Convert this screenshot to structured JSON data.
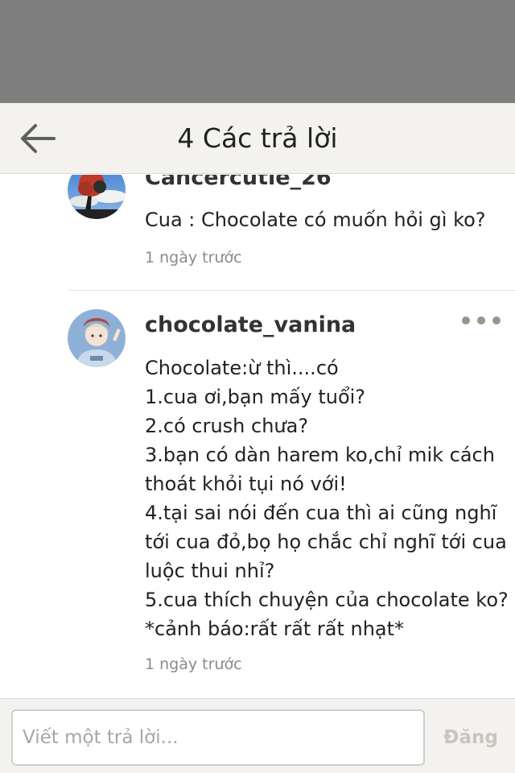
{
  "header": {
    "title": "4 Các trả lời"
  },
  "comments": [
    {
      "username": "Cancercutie_26",
      "lines": [
        "Cua : Chocolate có muốn hỏi gì ko?"
      ],
      "timestamp": "1 ngày trước"
    },
    {
      "username": "chocolate_vanina",
      "lines": [
        "Chocolate:ừ thì....có",
        "1.cua ơi,bạn mấy tuổi?",
        "2.có crush chưa?",
        "3.bạn có dàn harem ko,chỉ mik cách",
        "thoát khỏi tụi nó với!",
        "4.tại sai nói đến cua thì ai cũng nghĩ",
        "tới cua đỏ,bọ họ chắc chỉ nghĩ tới cua",
        "luộc thui nhỉ?",
        "5.cua thích chuyện của chocolate ko?",
        "*cảnh báo:rất rất rất nhạt*"
      ],
      "timestamp": "1 ngày trước"
    }
  ],
  "footer": {
    "reply_placeholder": "Viết một trả lời...",
    "post_label": "Đăng"
  },
  "icons": {
    "back": "arrow-left-icon",
    "more": "more-dots-icon"
  },
  "colors": {
    "status_bar": "#7f7f7f",
    "header_bg": "#f4f2ee",
    "post_disabled": "#c9c5be",
    "dots": "#9b9489"
  }
}
